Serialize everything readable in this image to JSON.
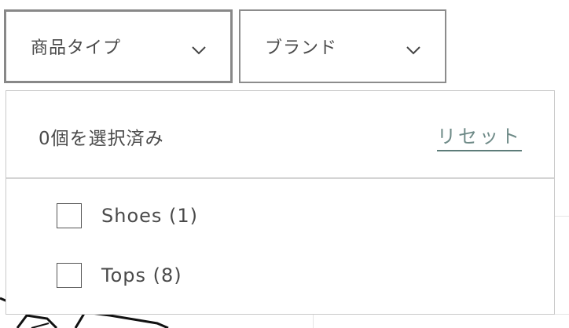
{
  "filters": {
    "product_type_label": "商品タイプ",
    "brand_label": "ブランド"
  },
  "dropdown": {
    "selected_count_text": "0個を選択済み",
    "reset_label": "リセット",
    "options": [
      {
        "label": "Shoes (1)",
        "checked": false
      },
      {
        "label": "Tops (8)",
        "checked": false
      }
    ]
  },
  "icons": {
    "filter_chevron": "chevron-down-icon"
  },
  "colors": {
    "reset_link": "#6e8a87",
    "text": "#4a4a4a",
    "active_border": "#888888"
  }
}
